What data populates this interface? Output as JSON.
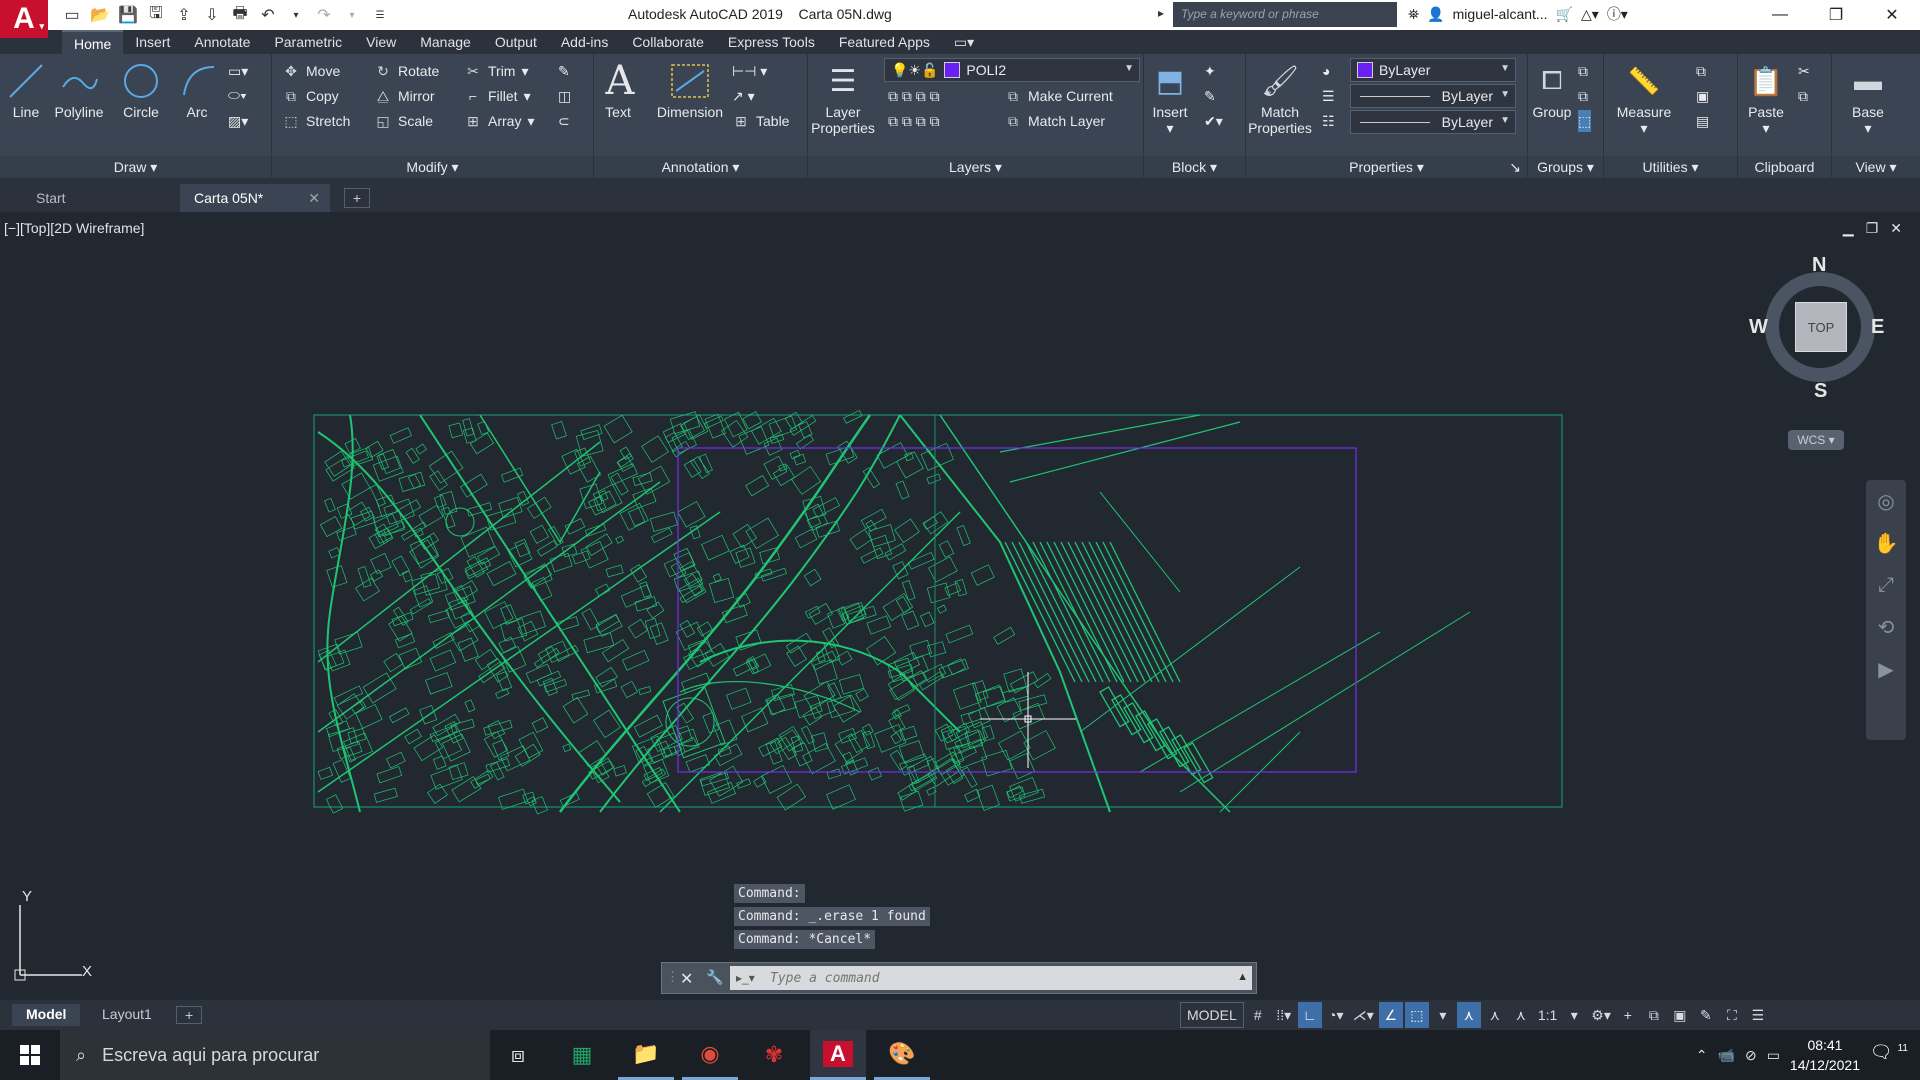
{
  "titlebar": {
    "app_name": "Autodesk AutoCAD 2019",
    "file_name": "Carta 05N.dwg",
    "search_placeholder": "Type a keyword or phrase",
    "user": "miguel-alcant..."
  },
  "menu": {
    "tabs": [
      "Home",
      "Insert",
      "Annotate",
      "Parametric",
      "View",
      "Manage",
      "Output",
      "Add-ins",
      "Collaborate",
      "Express Tools",
      "Featured Apps"
    ]
  },
  "ribbon": {
    "draw": {
      "title": "Draw",
      "line": "Line",
      "polyline": "Polyline",
      "circle": "Circle",
      "arc": "Arc"
    },
    "modify": {
      "title": "Modify",
      "move": "Move",
      "rotate": "Rotate",
      "trim": "Trim",
      "copy": "Copy",
      "mirror": "Mirror",
      "fillet": "Fillet",
      "stretch": "Stretch",
      "scale": "Scale",
      "array": "Array"
    },
    "annotation": {
      "title": "Annotation",
      "text": "Text",
      "dimension": "Dimension",
      "table": "Table"
    },
    "layers": {
      "title": "Layers",
      "layer_properties_1": "Layer",
      "layer_properties_2": "Properties",
      "current_layer": "POLI2",
      "make_current": "Make Current",
      "match_layer": "Match Layer"
    },
    "block": {
      "title": "Block",
      "insert": "Insert"
    },
    "properties": {
      "title": "Properties",
      "match_1": "Match",
      "match_2": "Properties",
      "color": "ByLayer",
      "linetype": "ByLayer",
      "lineweight": "ByLayer"
    },
    "groups": {
      "title": "Groups",
      "group": "Group"
    },
    "utilities": {
      "title": "Utilities",
      "measure": "Measure"
    },
    "clipboard": {
      "title": "Clipboard",
      "paste": "Paste"
    },
    "view": {
      "title": "View",
      "base": "Base"
    }
  },
  "file_tabs": {
    "start": "Start",
    "current": "Carta 05N*"
  },
  "viewport": {
    "label": "[−][Top][2D Wireframe]",
    "viewcube": {
      "top": "TOP",
      "n": "N",
      "s": "S",
      "e": "E",
      "w": "W",
      "wcs": "WCS"
    },
    "ucs": {
      "x": "X",
      "y": "Y"
    }
  },
  "command": {
    "history": [
      "Command:",
      "Command: _.erase 1 found",
      "Command: *Cancel*"
    ],
    "placeholder": "Type a command"
  },
  "layout_tabs": [
    "Model",
    "Layout1"
  ],
  "status": {
    "model": "MODEL",
    "scale": "1:1"
  },
  "taskbar": {
    "search_placeholder": "Escreva aqui para procurar",
    "time": "08:41",
    "date": "14/12/2021",
    "notification_count": "11"
  },
  "colors": {
    "drawing_green": "#1fd67a",
    "drawing_purple": "#7b2cf0",
    "background": "#212830",
    "ribbon": "#3b4452"
  }
}
